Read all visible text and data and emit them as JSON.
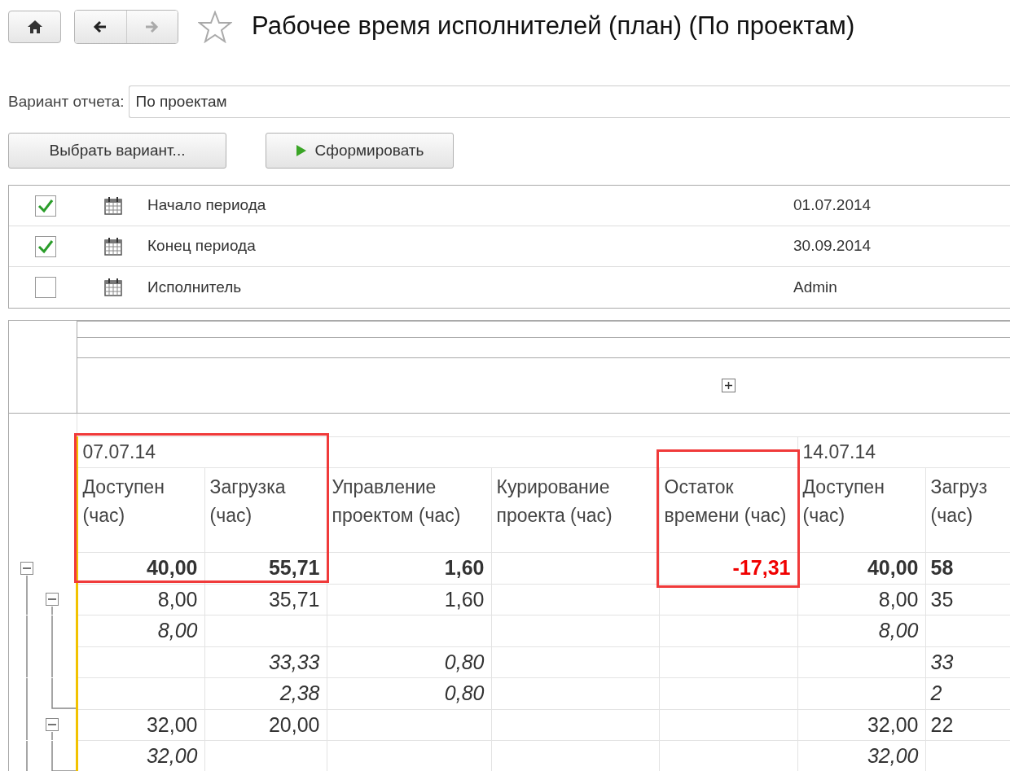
{
  "nav": {
    "back_enabled": true,
    "forward_enabled": false
  },
  "favorite": false,
  "title": "Рабочее время исполнителей (план) (По проектам)",
  "variant": {
    "label": "Вариант отчета:",
    "value": "По проектам"
  },
  "buttons": [
    {
      "kind": "plain",
      "label": "Выбрать вариант..."
    },
    {
      "kind": "run",
      "label": "Сформировать"
    }
  ],
  "parameters": [
    {
      "checked": true,
      "label": "Начало периода",
      "value": "01.07.2014"
    },
    {
      "checked": true,
      "label": "Конец периода",
      "value": "30.09.2014"
    },
    {
      "checked": false,
      "label": "Исполнитель",
      "value": "Admin"
    }
  ],
  "report": {
    "expanded_header": false,
    "period_groups": [
      {
        "label": "07.07.14",
        "columns": [
          {
            "label": "Доступен (час)",
            "framed": true
          },
          {
            "label": "Загрузка (час)",
            "framed": true
          },
          {
            "label": "Управление проектом (час)",
            "framed": false
          },
          {
            "label": "Курирование проекта (час)",
            "framed": false
          },
          {
            "label": "Остаток времени (час)",
            "framed": true
          }
        ]
      },
      {
        "label": "14.07.14",
        "columns": [
          {
            "label": "Доступен (час)",
            "framed": false
          },
          {
            "label": "Загруз (час)",
            "framed": false
          }
        ]
      }
    ],
    "rows": [
      {
        "kind": "total",
        "cells": [
          "40,00",
          "55,71",
          "1,60",
          "",
          {
            "value": "-17,31",
            "kind": "alert"
          },
          "40,00",
          "58"
        ],
        "expanded": true,
        "children": [
          {
            "kind": "group",
            "cells": [
              "8,00",
              "35,71",
              "1,60",
              "",
              "",
              "8,00",
              "35"
            ],
            "expanded": true,
            "children": [
              {
                "kind": "detail",
                "cells": [
                  "8,00",
                  "",
                  "",
                  "",
                  "",
                  "8,00",
                  ""
                ]
              },
              {
                "kind": "detail",
                "cells": [
                  "",
                  "33,33",
                  "0,80",
                  "",
                  "",
                  "",
                  "33"
                ]
              },
              {
                "kind": "detail",
                "cells": [
                  "",
                  "2,38",
                  "0,80",
                  "",
                  "",
                  "",
                  "2"
                ]
              }
            ]
          },
          {
            "kind": "group",
            "cells": [
              "32,00",
              "20,00",
              "",
              "",
              "",
              "32,00",
              "22"
            ],
            "expanded": true,
            "children": [
              {
                "kind": "detail",
                "cells": [
                  "32,00",
                  "",
                  "",
                  "",
                  "",
                  "32,00",
                  ""
                ]
              }
            ]
          }
        ]
      }
    ]
  }
}
